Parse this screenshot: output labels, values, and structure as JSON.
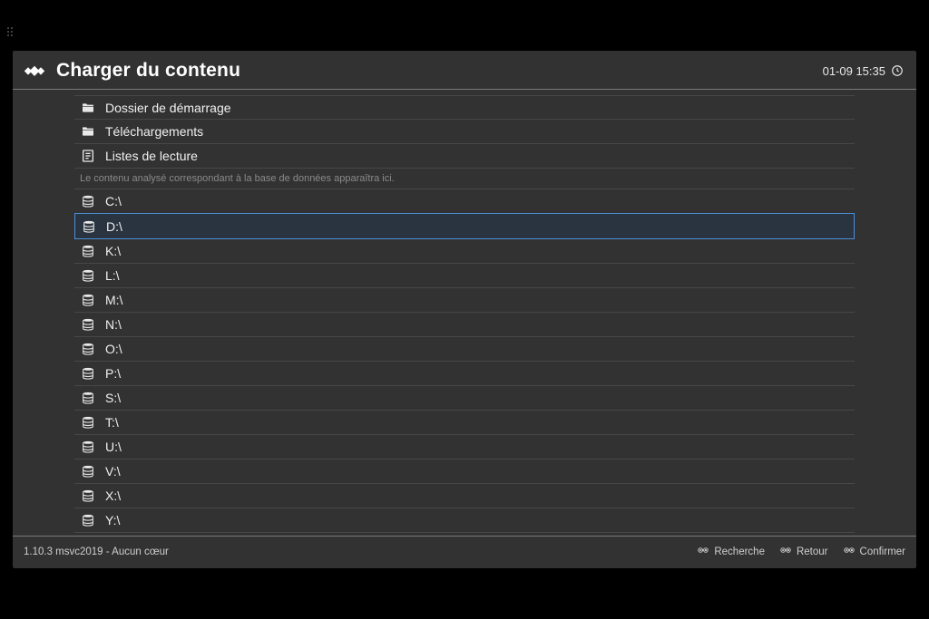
{
  "header": {
    "title": "Charger du contenu",
    "clock": "01-09 15:35"
  },
  "folders": [
    {
      "label": "Dossier de démarrage",
      "icon": "folder"
    },
    {
      "label": "Téléchargements",
      "icon": "folder"
    },
    {
      "label": "Listes de lecture",
      "icon": "playlist"
    }
  ],
  "hint_text": "Le contenu analysé correspondant à la base de données apparaîtra ici.",
  "drives": [
    {
      "label": "C:\\",
      "selected": false
    },
    {
      "label": "D:\\",
      "selected": true
    },
    {
      "label": "K:\\",
      "selected": false
    },
    {
      "label": "L:\\",
      "selected": false
    },
    {
      "label": "M:\\",
      "selected": false
    },
    {
      "label": "N:\\",
      "selected": false
    },
    {
      "label": "O:\\",
      "selected": false
    },
    {
      "label": "P:\\",
      "selected": false
    },
    {
      "label": "S:\\",
      "selected": false
    },
    {
      "label": "T:\\",
      "selected": false
    },
    {
      "label": "U:\\",
      "selected": false
    },
    {
      "label": "V:\\",
      "selected": false
    },
    {
      "label": "X:\\",
      "selected": false
    },
    {
      "label": "Y:\\",
      "selected": false
    }
  ],
  "footer": {
    "version": "1.10.3 msvc2019 - Aucun cœur",
    "hints": [
      {
        "label": "Recherche"
      },
      {
        "label": "Retour"
      },
      {
        "label": "Confirmer"
      }
    ]
  }
}
